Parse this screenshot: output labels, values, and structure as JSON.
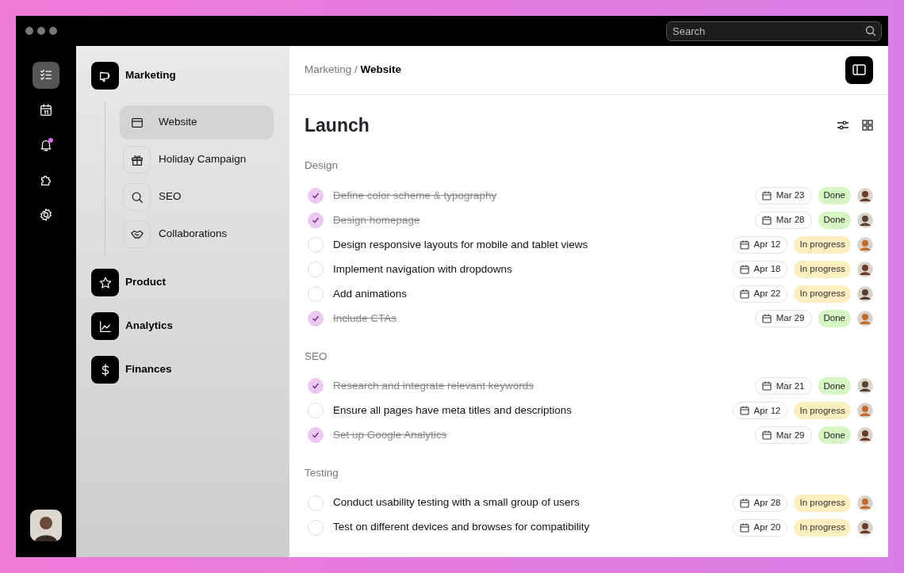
{
  "search": {
    "placeholder": "Search"
  },
  "rail": [
    {
      "kind": "tasks",
      "selected": true
    },
    {
      "kind": "calendar",
      "selected": false
    },
    {
      "kind": "bell",
      "selected": false,
      "badge": true
    },
    {
      "kind": "puzzle",
      "selected": false
    },
    {
      "kind": "gear",
      "selected": false
    }
  ],
  "sidebar": {
    "items": [
      {
        "label": "Marketing",
        "kind": "megaphone",
        "children": [
          {
            "label": "Website",
            "kind": "window",
            "selected": true
          },
          {
            "label": "Holiday Campaign",
            "kind": "gift",
            "selected": false
          },
          {
            "label": "SEO",
            "kind": "search",
            "selected": false
          },
          {
            "label": "Collaborations",
            "kind": "handshake",
            "selected": false
          }
        ]
      },
      {
        "label": "Product",
        "kind": "star"
      },
      {
        "label": "Analytics",
        "kind": "chart"
      },
      {
        "label": "Finances",
        "kind": "dollar"
      }
    ]
  },
  "breadcrumb": "Marketing / **Website**",
  "title": "Launch",
  "sections": [
    {
      "title": "Design",
      "tasks": [
        {
          "text": "Define color scheme & typography",
          "checked": true,
          "date": "Mar 23",
          "status": {
            "label": "Done",
            "kind": "done"
          }
        },
        {
          "text": "Design homepage",
          "checked": true,
          "date": "Mar 28",
          "status": {
            "label": "Done",
            "kind": "done"
          }
        },
        {
          "text": "Design responsive layouts for mobile and tablet views",
          "checked": false,
          "date": "Apr 12",
          "status": {
            "label": "In progress",
            "kind": "progress"
          }
        },
        {
          "text": "Implement navigation with dropdowns",
          "checked": false,
          "date": "Apr 18",
          "status": {
            "label": "In progress",
            "kind": "progress"
          }
        },
        {
          "text": "Add animations",
          "checked": false,
          "date": "Apr 22",
          "status": {
            "label": "In progress",
            "kind": "progress"
          }
        },
        {
          "text": "Include CTAs",
          "checked": true,
          "date": "Mar 29",
          "status": {
            "label": "Done",
            "kind": "done"
          }
        }
      ]
    },
    {
      "title": "SEO",
      "tasks": [
        {
          "text": "Research and integrate relevant keywords",
          "checked": true,
          "date": "Mar 21",
          "status": {
            "label": "Done",
            "kind": "done"
          }
        },
        {
          "text": "Ensure all pages have meta titles and descriptions",
          "checked": false,
          "date": "Apr 12",
          "status": {
            "label": "In progress",
            "kind": "progress"
          }
        },
        {
          "text": "Set up Google Analytics",
          "checked": true,
          "date": "Mar 29",
          "status": {
            "label": "Done",
            "kind": "done"
          }
        }
      ]
    },
    {
      "title": "Testing",
      "tasks": [
        {
          "text": "Conduct usability testing with a small group of users",
          "checked": false,
          "date": "Apr 28",
          "status": {
            "label": "In progress",
            "kind": "progress"
          }
        },
        {
          "text": "Test on different devices and browses for compatibility",
          "checked": false,
          "date": "Apr 20",
          "status": {
            "label": "In progress",
            "kind": "progress"
          }
        }
      ]
    }
  ]
}
